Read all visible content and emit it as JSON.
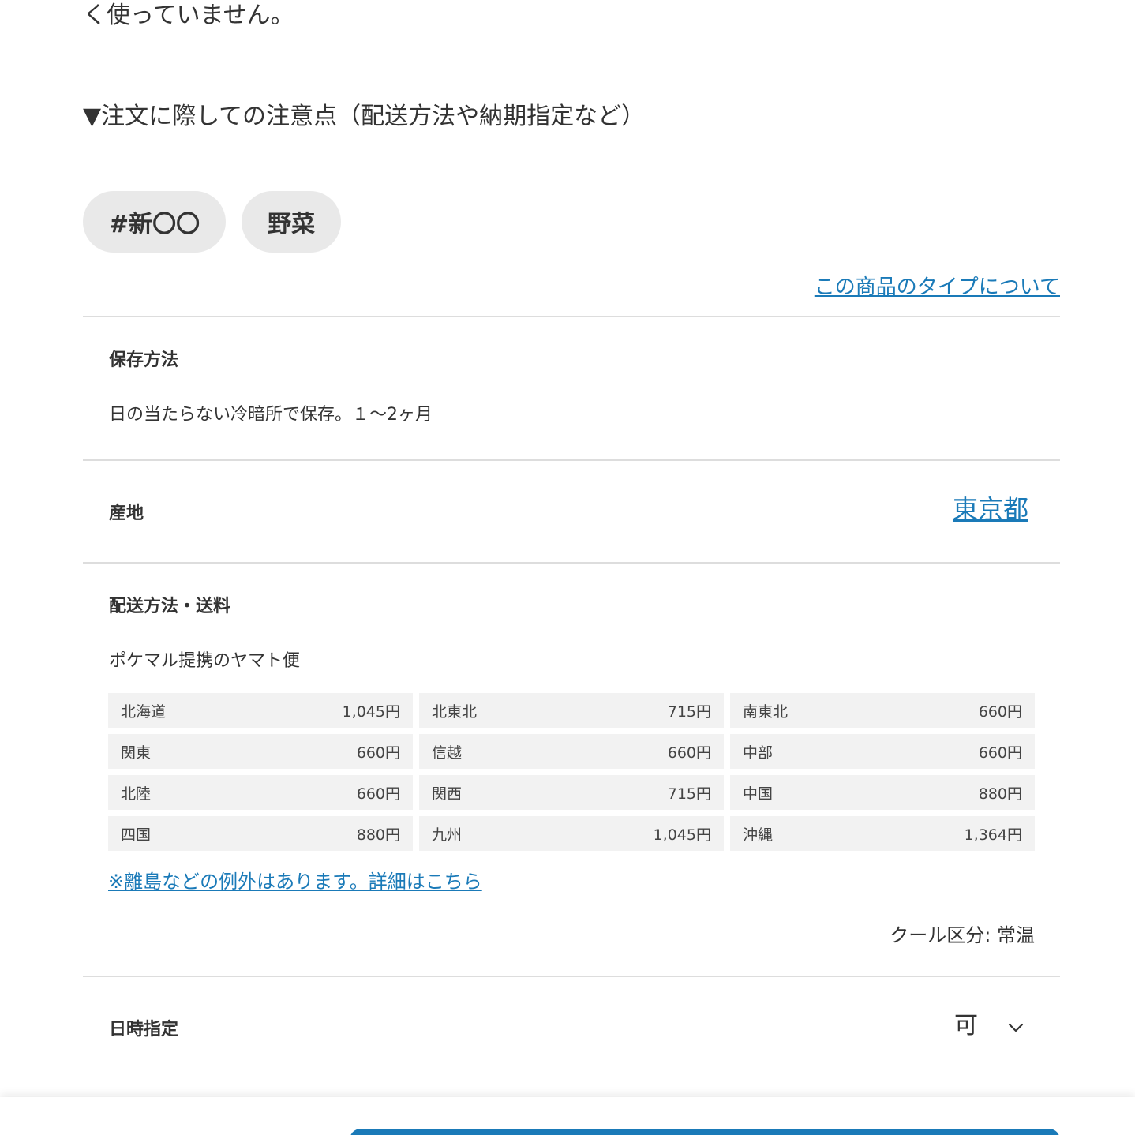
{
  "intro_text": "く使っていません。",
  "notes_heading": "▼注文に際しての注意点（配送方法や納期指定など）",
  "tags": [
    "#新〇〇",
    "野菜"
  ],
  "type_link": "この商品のタイプについて",
  "storage": {
    "label": "保存方法",
    "value": "日の当たらない冷暗所で保存。１～2ヶ月"
  },
  "origin": {
    "label": "産地",
    "value": "東京都"
  },
  "shipping": {
    "label": "配送方法・送料",
    "method": "ポケマル提携のヤマト便",
    "fees": [
      {
        "region": "北海道",
        "price": "1,045円"
      },
      {
        "region": "北東北",
        "price": "715円"
      },
      {
        "region": "南東北",
        "price": "660円"
      },
      {
        "region": "関東",
        "price": "660円"
      },
      {
        "region": "信越",
        "price": "660円"
      },
      {
        "region": "中部",
        "price": "660円"
      },
      {
        "region": "北陸",
        "price": "660円"
      },
      {
        "region": "関西",
        "price": "715円"
      },
      {
        "region": "中国",
        "price": "880円"
      },
      {
        "region": "四国",
        "price": "880円"
      },
      {
        "region": "九州",
        "price": "1,045円"
      },
      {
        "region": "沖縄",
        "price": "1,364円"
      }
    ],
    "exception_link": "※離島などの例外はあります。詳細はこちら",
    "cool_type": "クール区分: 常温"
  },
  "datetime": {
    "label": "日時指定",
    "value": "可"
  },
  "colors": {
    "link": "#1a7ab8",
    "tag_bg": "#e9e9e9",
    "cell_bg": "#f2f2f2",
    "divider": "#dddddd"
  },
  "icons": {
    "datetime_toggle": "chevron-down-icon"
  }
}
